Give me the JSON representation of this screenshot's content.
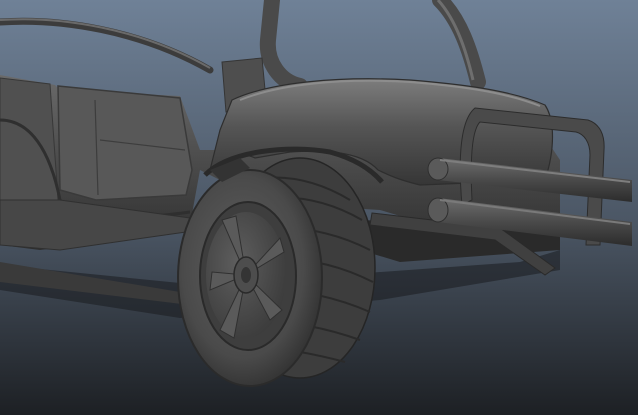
{
  "viewport": {
    "background_top": "#6f8197",
    "background_bottom": "#1d2024",
    "model_color": "#4b4b4b",
    "shadow_color": "#141414",
    "highlight_color": "#7a7a7a"
  },
  "scene": {
    "subject": "dune-buggy-model",
    "shading": "smooth-untextured"
  }
}
